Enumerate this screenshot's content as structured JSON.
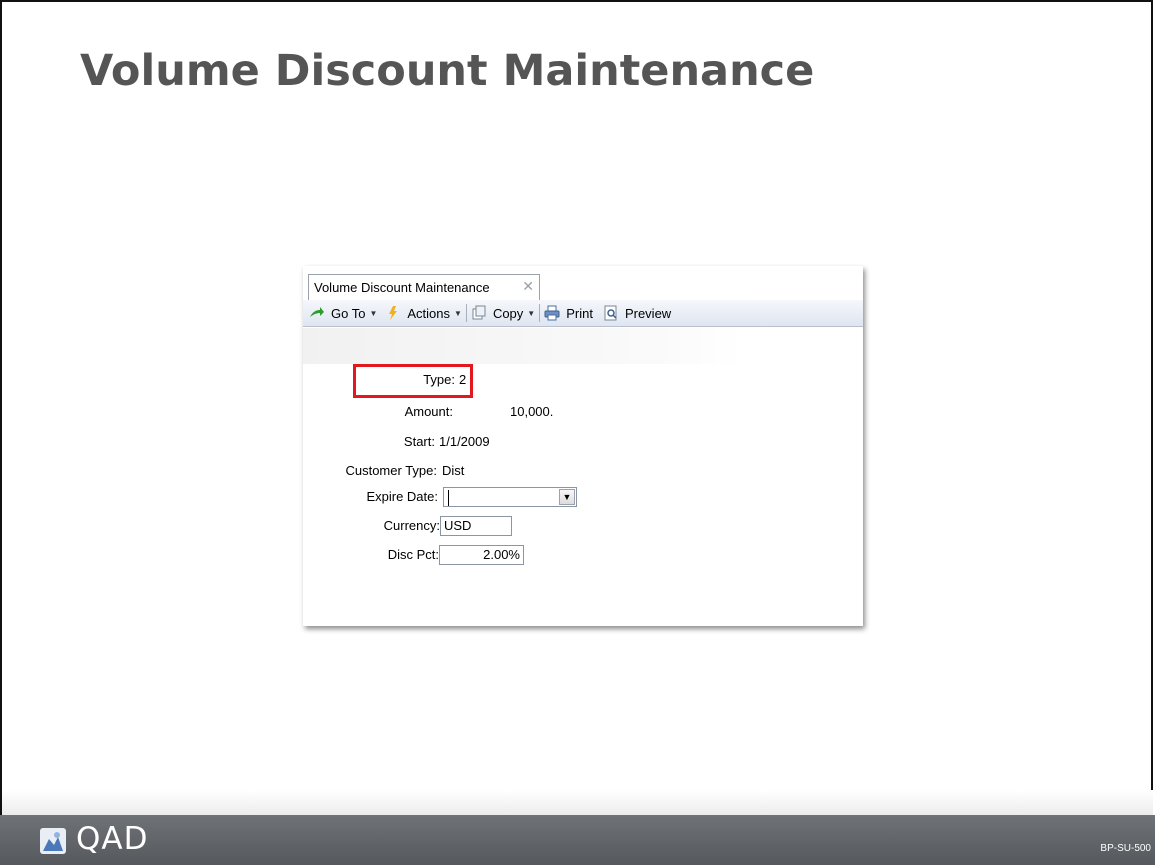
{
  "slide": {
    "title": "Volume Discount Maintenance",
    "footer_logo": "QAD",
    "footer_code": "BP-SU-500"
  },
  "app": {
    "tab_label": "Volume Discount Maintenance",
    "tab_close_icon": "close-icon",
    "toolbar": {
      "goto_label": "Go To",
      "actions_label": "Actions",
      "copy_label": "Copy",
      "print_label": "Print",
      "preview_label": "Preview"
    },
    "form": {
      "type_label": "Type:",
      "type_value": "2",
      "amount_label": "Amount:",
      "amount_value": "10,000.",
      "start_label": "Start:",
      "start_value": "1/1/2009",
      "customer_type_label": "Customer Type:",
      "customer_type_value": "Dist",
      "expire_date_label": "Expire Date:",
      "expire_date_value": "",
      "currency_label": "Currency:",
      "currency_value": "USD",
      "disc_pct_label": "Disc Pct:",
      "disc_pct_value": "2.00%"
    }
  },
  "colors": {
    "title_gray": "#555555",
    "footer_bar": "#5f6367",
    "highlight_red": "#e3171e"
  }
}
